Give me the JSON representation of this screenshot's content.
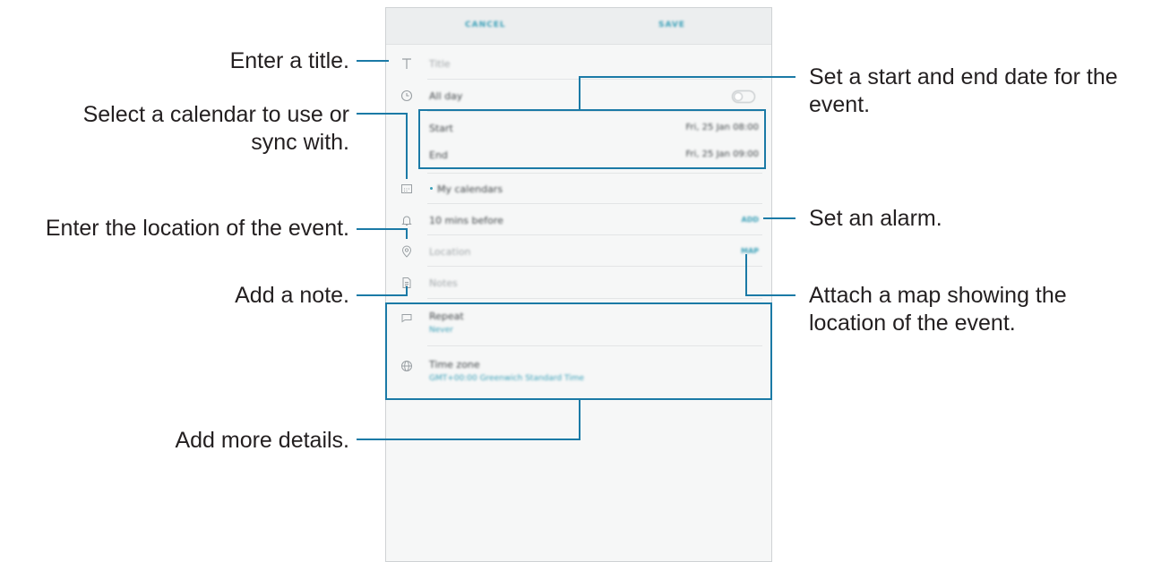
{
  "phone": {
    "top_bar": {
      "cancel_label": "CANCEL",
      "save_label": "SAVE"
    },
    "title_placeholder": "Title",
    "all_day_label": "All day",
    "all_day_on": false,
    "start_label": "Start",
    "start_value": "Fri, 25 Jan 08:00",
    "end_label": "End",
    "end_value": "Fri, 25 Jan 09:00",
    "calendar_label": "My calendars",
    "alarm_label": "10 mins before",
    "alarm_action": "ADD",
    "location_placeholder": "Location",
    "map_action": "MAP",
    "notes_placeholder": "Notes",
    "repeat_label": "Repeat",
    "repeat_value": "Never",
    "timezone_label": "Time zone",
    "timezone_value": "GMT+00:00 Greenwich Standard Time"
  },
  "callouts": {
    "title": "Enter a title.",
    "calendar": "Select a calendar to use or sync with.",
    "calendar_line1": "Select a calendar to use or",
    "calendar_line2": "sync with.",
    "location": "Enter the location of the event.",
    "note": "Add a note.",
    "details": "Add more details.",
    "dates": "Set a start and end date for the event.",
    "dates_line1": "Set a start and end date for the",
    "dates_line2": "event.",
    "alarm": "Set an alarm.",
    "map": "Attach a map showing the location of the event.",
    "map_line1": "Attach a map showing the",
    "map_line2": "location of the event."
  },
  "colors": {
    "accent": "#1b7aa6",
    "link": "#3aa0b8",
    "text": "#231f20"
  }
}
